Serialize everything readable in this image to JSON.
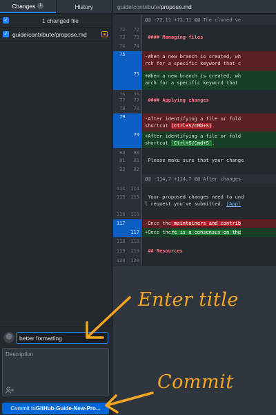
{
  "tabs": [
    {
      "label": "Changes",
      "badge": "1"
    },
    {
      "label": "History"
    }
  ],
  "changes": {
    "count_label": "1 changed file",
    "file": "guide/contribute/propose.md"
  },
  "path": {
    "prefix": "guide/contribute/",
    "file": "propose.md"
  },
  "commit": {
    "summary_value": "better formatting",
    "description_placeholder": "Description",
    "button_prefix": "Commit to ",
    "button_branch": "GitHub-Guide-New-Pro..."
  },
  "annotations": {
    "title": "Enter title",
    "commit": "Commit"
  },
  "diff": {
    "hunk1": "@@ -72,11 +72,11 @@ The cloned ve",
    "line_managing": "#### Managing files",
    "del75a": "-When a new branch is created, wh",
    "del75b": "rch for a specific keyword that c",
    "add75a": "+When a new branch is created, wh",
    "add75b": "arch for a specific keyword that",
    "line_applying": "#### Applying changes",
    "del79a": "-After identifying a file or fold",
    "del79b_pre": "shortcut ",
    "del79b_key": "(Ctrl+S/CMD+S)",
    "del79b_post": ".",
    "add79a": "+After identifying a file or fold",
    "add79b_pre": "shortcut ",
    "add79b_key": "`Ctrl+S/Cmd+S`",
    "add79b_post": ".",
    "line_please": " Please make sure that your change",
    "hunk2": "@@ -114,7 +114,7 @@ After changes",
    "line_proposed": " Your proposed changes need to und",
    "line_request_pre": "l request you've submitted. ",
    "line_request_link": "[Appl",
    "del117_pre": "-Once the",
    "del117_hl": " maintainers and contrib",
    "add117_pre": "+Once the",
    "add117_hl": "re is a consensus on the",
    "line_resources": "## Resources"
  }
}
